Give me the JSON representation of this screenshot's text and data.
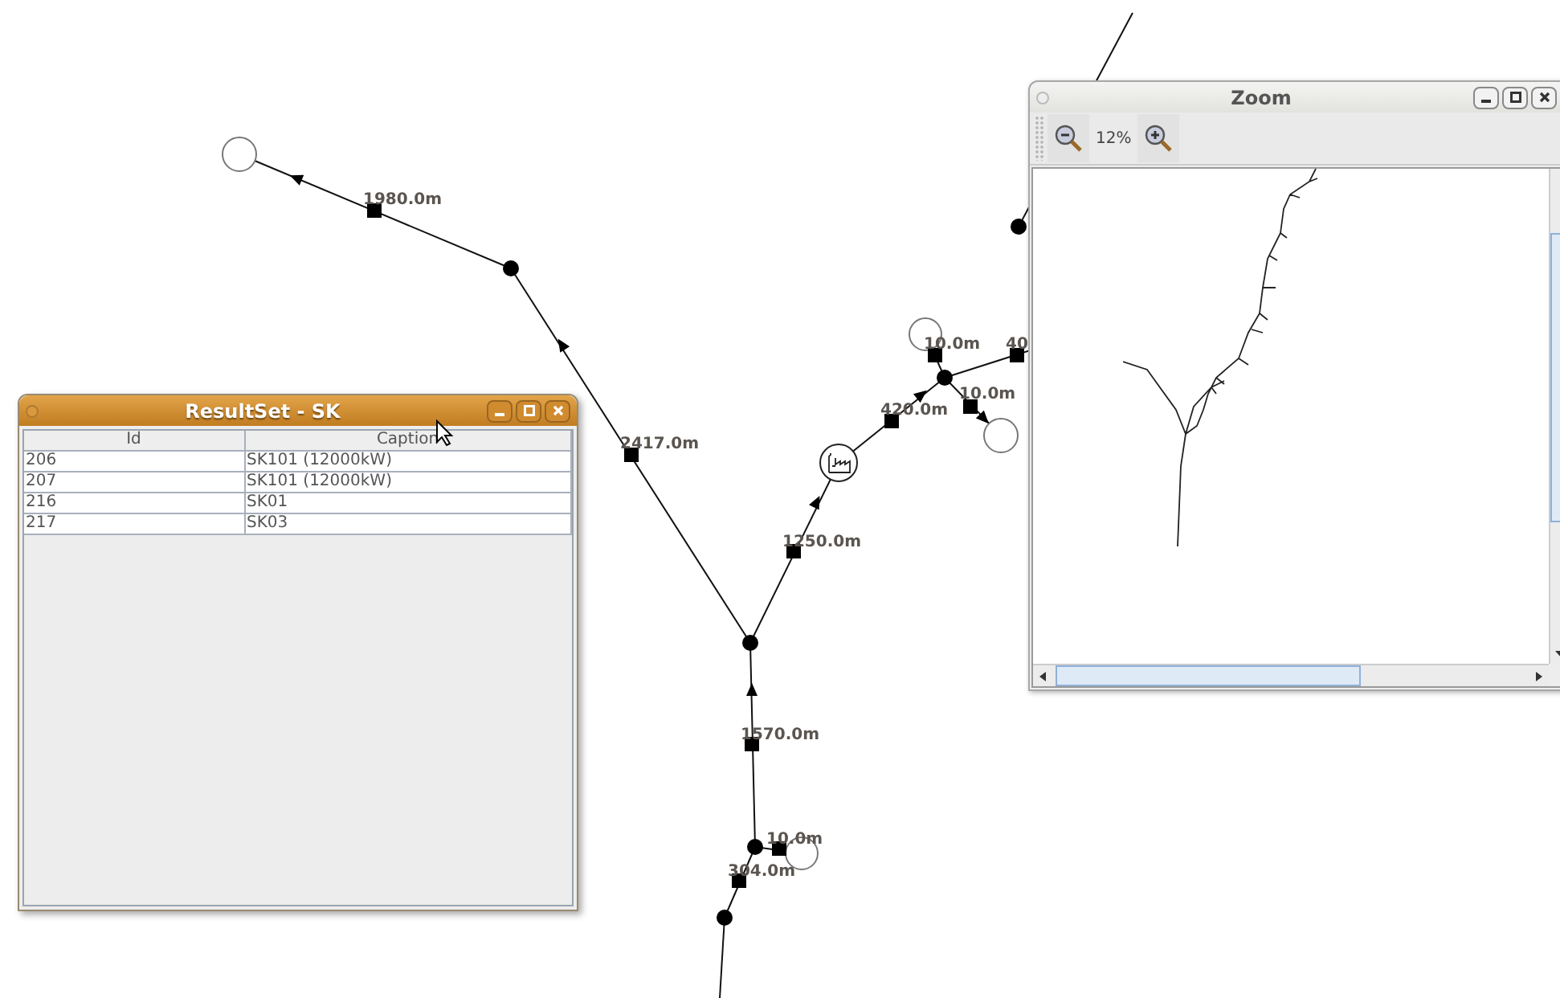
{
  "diagram": {
    "edge_labels": [
      "1980.0m",
      "2417.0m",
      "1250.0m",
      "420.0m",
      "10.0m",
      "40",
      "10.0m",
      "1570.0m",
      "10.0m",
      "304.0m"
    ]
  },
  "result_window": {
    "title": "ResultSet - SK",
    "columns": [
      "Id",
      "Caption"
    ],
    "rows": [
      [
        "206",
        "SK101 (12000kW)"
      ],
      [
        "207",
        "SK101 (12000kW)"
      ],
      [
        "216",
        "SK01"
      ],
      [
        "217",
        "SK03"
      ]
    ]
  },
  "zoom_window": {
    "title": "Zoom",
    "zoom_level": "12%"
  }
}
